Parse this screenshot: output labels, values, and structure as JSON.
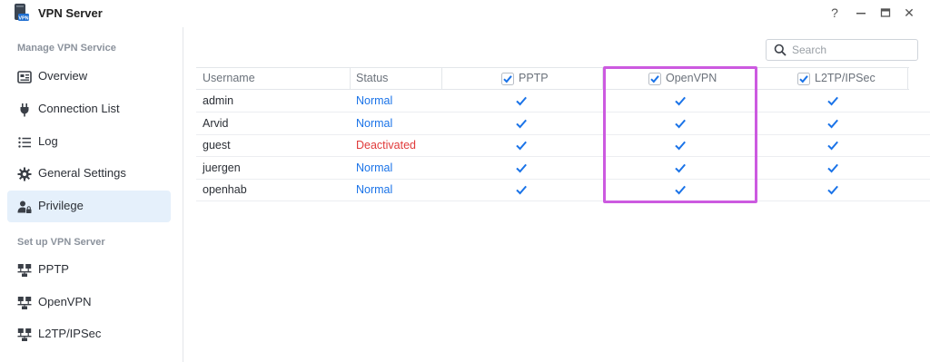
{
  "window": {
    "title": "VPN Server",
    "controls": [
      "help",
      "minimize",
      "maximize",
      "close"
    ],
    "help_glyph": "?",
    "close_glyph": "✕"
  },
  "sidebar": {
    "sections": [
      {
        "title": "Manage VPN Service",
        "items": [
          {
            "label": "Overview",
            "icon": "overview-icon"
          },
          {
            "label": "Connection List",
            "icon": "plug-icon"
          },
          {
            "label": "Log",
            "icon": "list-icon"
          },
          {
            "label": "General Settings",
            "icon": "gear-icon"
          },
          {
            "label": "Privilege",
            "icon": "user-lock-icon",
            "active": true
          }
        ]
      },
      {
        "title": "Set up VPN Server",
        "items": [
          {
            "label": "PPTP",
            "icon": "network-icon"
          },
          {
            "label": "OpenVPN",
            "icon": "network-icon"
          },
          {
            "label": "L2TP/IPSec",
            "icon": "network-icon"
          }
        ]
      }
    ]
  },
  "search": {
    "placeholder": "Search",
    "value": ""
  },
  "table": {
    "columns": {
      "username": "Username",
      "status": "Status",
      "pptp": "PPTP",
      "openvpn": "OpenVPN",
      "l2tp": "L2TP/IPSec"
    },
    "header_checked": {
      "pptp": true,
      "openvpn": true,
      "l2tp": true
    },
    "rows": [
      {
        "username": "admin",
        "status": "Normal",
        "status_type": "normal",
        "pptp": true,
        "openvpn": true,
        "l2tp": true
      },
      {
        "username": "Arvid",
        "status": "Normal",
        "status_type": "normal",
        "pptp": true,
        "openvpn": true,
        "l2tp": true
      },
      {
        "username": "guest",
        "status": "Deactivated",
        "status_type": "deactivated",
        "pptp": true,
        "openvpn": true,
        "l2tp": true
      },
      {
        "username": "juergen",
        "status": "Normal",
        "status_type": "normal",
        "pptp": true,
        "openvpn": true,
        "l2tp": true
      },
      {
        "username": "openhab",
        "status": "Normal",
        "status_type": "normal",
        "pptp": true,
        "openvpn": true,
        "l2tp": true
      }
    ]
  },
  "colors": {
    "accent": "#1a73e8",
    "status_normal": "#1a73e8",
    "status_deactivated": "#e03a3a",
    "highlight": "#cc5ae0",
    "active_nav_bg": "#e5f0fb"
  }
}
